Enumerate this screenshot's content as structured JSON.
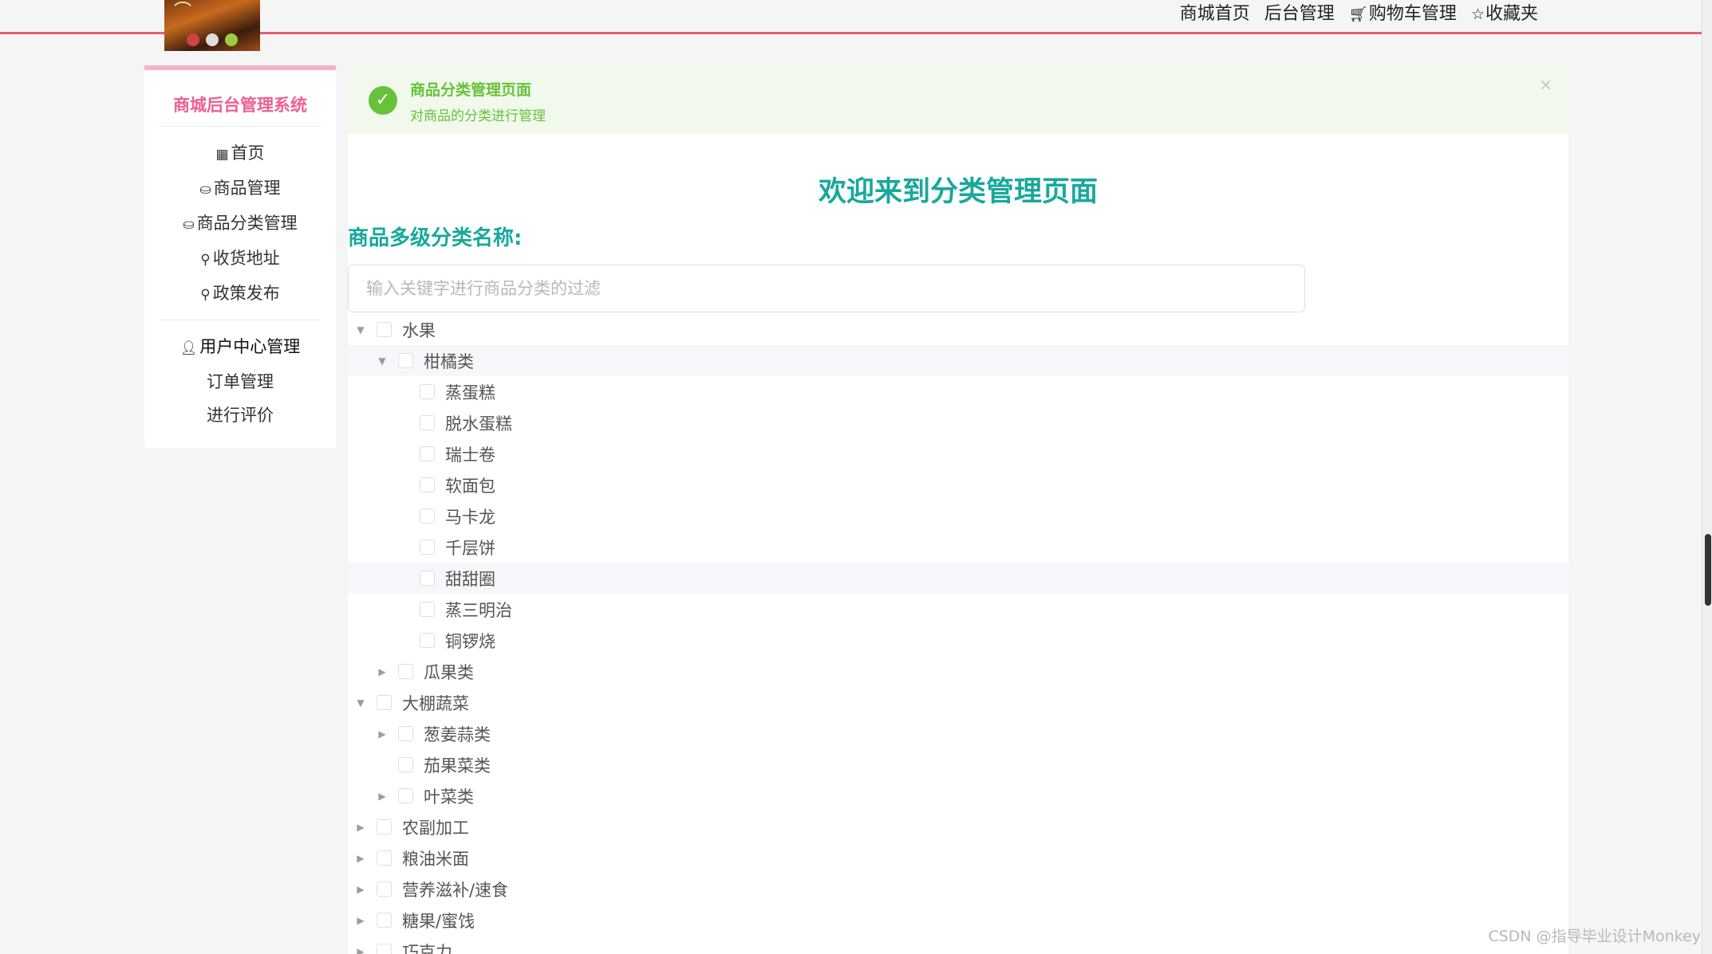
{
  "header": {
    "nav": [
      {
        "label": "商城首页",
        "icon": ""
      },
      {
        "label": "后台管理",
        "icon": ""
      },
      {
        "label": "购物车管理",
        "icon": "cart-icon"
      },
      {
        "label": "收藏夹",
        "icon": "star-icon"
      }
    ]
  },
  "sidebar": {
    "title": "商城后台管理系统",
    "items": [
      {
        "label": "首页",
        "icon": "grid-icon"
      },
      {
        "label": "商品管理",
        "icon": "box-icon"
      },
      {
        "label": "商品分类管理",
        "icon": "box-icon"
      },
      {
        "label": "收货地址",
        "icon": "location-icon"
      },
      {
        "label": "政策发布",
        "icon": "location-icon"
      }
    ],
    "user_section": {
      "label": "用户中心管理",
      "icon": "user-icon",
      "items": [
        {
          "label": "订单管理"
        },
        {
          "label": "进行评价"
        }
      ]
    }
  },
  "alert": {
    "title": "商品分类管理页面",
    "description": "对商品的分类进行管理",
    "close": "×"
  },
  "main": {
    "welcome": "欢迎来到分类管理页面",
    "category_label": "商品多级分类名称:",
    "filter_placeholder": "输入关键字进行商品分类的过滤"
  },
  "tree": [
    {
      "label": "水果",
      "level": 0,
      "state": "expanded",
      "highlight": false
    },
    {
      "label": "柑橘类",
      "level": 1,
      "state": "expanded",
      "highlight": true
    },
    {
      "label": "蒸蛋糕",
      "level": 2,
      "state": "leaf",
      "highlight": false
    },
    {
      "label": "脱水蛋糕",
      "level": 2,
      "state": "leaf",
      "highlight": false
    },
    {
      "label": "瑞士卷",
      "level": 2,
      "state": "leaf",
      "highlight": false
    },
    {
      "label": "软面包",
      "level": 2,
      "state": "leaf",
      "highlight": false
    },
    {
      "label": "马卡龙",
      "level": 2,
      "state": "leaf",
      "highlight": false
    },
    {
      "label": "千层饼",
      "level": 2,
      "state": "leaf",
      "highlight": false
    },
    {
      "label": "甜甜圈",
      "level": 2,
      "state": "leaf",
      "highlight": true
    },
    {
      "label": "蒸三明治",
      "level": 2,
      "state": "leaf",
      "highlight": false
    },
    {
      "label": "铜锣烧",
      "level": 2,
      "state": "leaf",
      "highlight": false
    },
    {
      "label": "瓜果类",
      "level": 1,
      "state": "collapsed",
      "highlight": false
    },
    {
      "label": "大棚蔬菜",
      "level": 0,
      "state": "expanded",
      "highlight": false
    },
    {
      "label": "葱姜蒜类",
      "level": 1,
      "state": "collapsed",
      "highlight": false
    },
    {
      "label": "茄果菜类",
      "level": 1,
      "state": "leaf",
      "highlight": false
    },
    {
      "label": "叶菜类",
      "level": 1,
      "state": "collapsed",
      "highlight": false
    },
    {
      "label": "农副加工",
      "level": 0,
      "state": "collapsed",
      "highlight": false
    },
    {
      "label": "粮油米面",
      "level": 0,
      "state": "collapsed",
      "highlight": false
    },
    {
      "label": "营养滋补/速食",
      "level": 0,
      "state": "collapsed",
      "highlight": false
    },
    {
      "label": "糖果/蜜饯",
      "level": 0,
      "state": "collapsed",
      "highlight": false
    },
    {
      "label": "巧克力",
      "level": 0,
      "state": "collapsed",
      "highlight": false
    }
  ],
  "watermark": "CSDN @指导毕业设计Monkey"
}
